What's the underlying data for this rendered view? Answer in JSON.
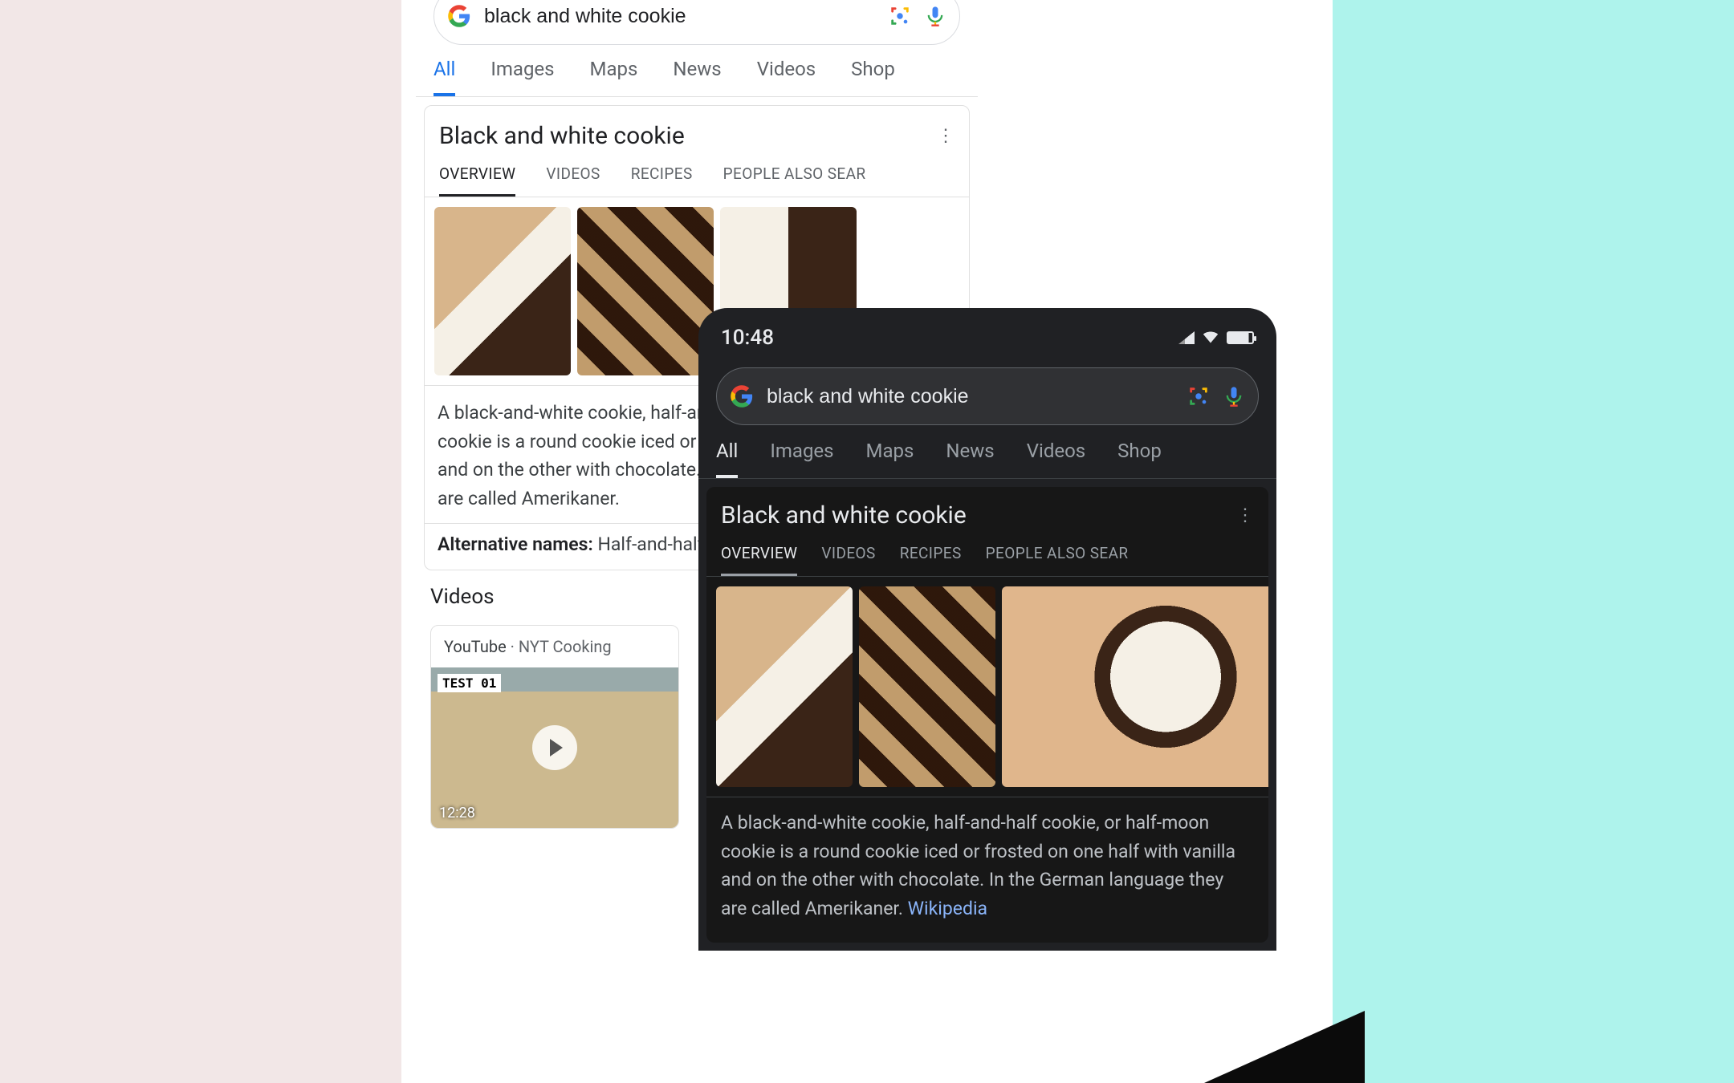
{
  "status": {
    "time": "10:48"
  },
  "search": {
    "query": "black and white cookie"
  },
  "tabs": {
    "all": "All",
    "images": "Images",
    "maps": "Maps",
    "news": "News",
    "videos": "Videos",
    "shopping": "Shop"
  },
  "knowledge": {
    "title": "Black and white cookie",
    "subtabs": {
      "overview": "OVERVIEW",
      "videos": "VIDEOS",
      "recipes": "RECIPES",
      "people_also": "PEOPLE ALSO SEAR"
    },
    "description_light": "A black-and-white cookie, half-and-half cookie, or half-moon cookie is a round cookie iced or frosted on one half with vanilla and on the other with chocolate. In the German language they are called Amerikaner.",
    "description_dark": "A black-and-white cookie, half-and-half cookie, or half-moon cookie is a round cookie iced or frosted on one half with vanilla and on the other with chocolate. In the German language they are called Amerikaner. ",
    "wikipedia": "Wikipedia",
    "altnames_label": "Alternative names:",
    "altnames_value": " Half-and-half"
  },
  "videos": {
    "section_title": "Videos",
    "card": {
      "source": "YouTube",
      "sep": " · ",
      "channel": "NYT Cooking",
      "badge": "TEST 01",
      "duration": "12:28"
    }
  }
}
